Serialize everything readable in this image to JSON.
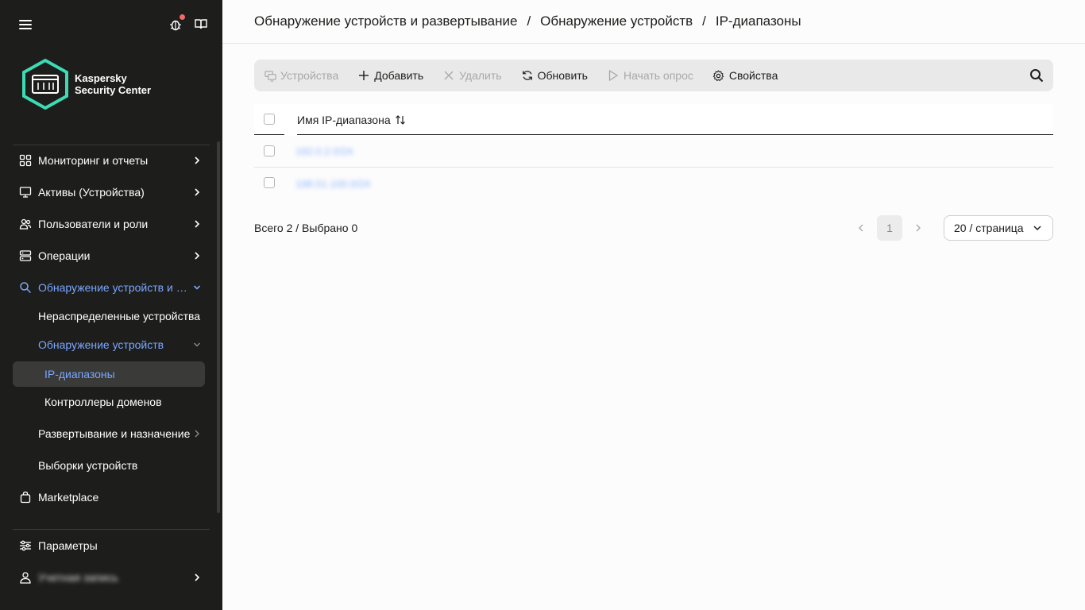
{
  "sidebar": {
    "brand_line1": "Kaspersky",
    "brand_line2": "Security Center",
    "items": [
      {
        "label": "Мониторинг и отчеты"
      },
      {
        "label": "Активы (Устройства)"
      },
      {
        "label": "Пользователи и роли"
      },
      {
        "label": "Операции"
      },
      {
        "label": "Обнаружение устройств и развертывание"
      },
      {
        "label": "Нераспределенные устройства"
      },
      {
        "label": "Обнаружение устройств"
      },
      {
        "label": "IP-диапазоны"
      },
      {
        "label": "Контроллеры доменов"
      },
      {
        "label": "Развертывание и назначение"
      },
      {
        "label": "Выборки устройств"
      },
      {
        "label": "Marketplace"
      },
      {
        "label": "Параметры"
      },
      {
        "label": "Учетная запись"
      }
    ]
  },
  "breadcrumb": {
    "part1": "Обнаружение устройств и развертывание",
    "part2": "Обнаружение устройств",
    "part3": "IP-диапазоны",
    "separator": "/"
  },
  "toolbar": {
    "devices": "Устройства",
    "add": "Добавить",
    "delete": "Удалить",
    "refresh": "Обновить",
    "start_poll": "Начать опрос",
    "properties": "Свойства"
  },
  "table": {
    "column_name": "Имя IP-диапазона",
    "rows": [
      {
        "name": "192.0.2.0/24"
      },
      {
        "name": "198.51.100.0/24"
      }
    ]
  },
  "footer": {
    "total": "Всего 2 / Выбрано 0",
    "page": "1",
    "page_size": "20 / страница"
  },
  "colors": {
    "sidebar_bg": "#1d1d1b",
    "accent": "#7aa7ff",
    "logo_teal": "#3ddbb4",
    "notification_dot": "#ef6a6a"
  }
}
